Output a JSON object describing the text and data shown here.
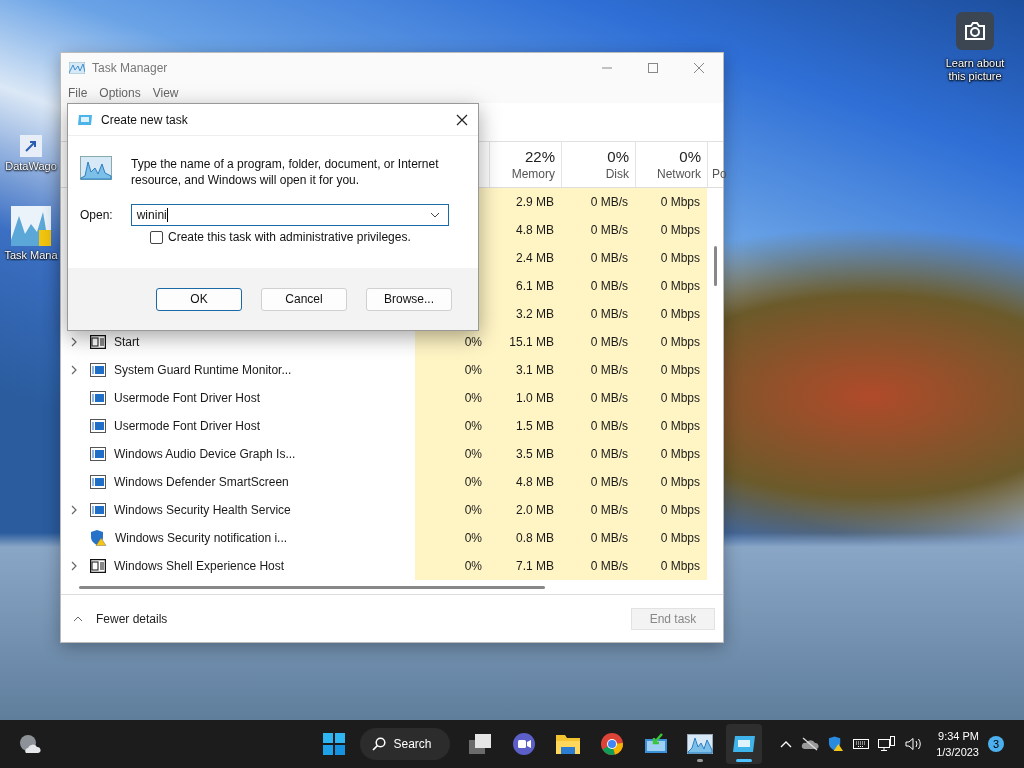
{
  "desktop": {
    "icons": [
      {
        "label": "DataWago",
        "kind": "shortcut-map"
      },
      {
        "label": "Task Mana",
        "kind": "shortcut-chart"
      }
    ],
    "spotlight": {
      "label": "Learn about this picture"
    }
  },
  "task_manager": {
    "title": "Task Manager",
    "menu": [
      "File",
      "Options",
      "View"
    ],
    "columns": [
      {
        "percent": "22%",
        "label": "Memory"
      },
      {
        "percent": "0%",
        "label": "Disk"
      },
      {
        "percent": "0%",
        "label": "Network"
      },
      {
        "label": "Po"
      }
    ],
    "rows": [
      {
        "memory": "2.9 MB",
        "disk": "0 MB/s",
        "network": "0 Mbps"
      },
      {
        "memory": "4.8 MB",
        "disk": "0 MB/s",
        "network": "0 Mbps"
      },
      {
        "memory": "2.4 MB",
        "disk": "0 MB/s",
        "network": "0 Mbps"
      },
      {
        "memory": "6.1 MB",
        "disk": "0 MB/s",
        "network": "0 Mbps"
      },
      {
        "memory": "3.2 MB",
        "disk": "0 MB/s",
        "network": "0 Mbps"
      },
      {
        "expandable": true,
        "kind": "dark-window",
        "name": "Start",
        "cpu": "0%",
        "memory": "15.1 MB",
        "disk": "0 MB/s",
        "network": "0 Mbps"
      },
      {
        "expandable": true,
        "kind": "app",
        "name": "System Guard Runtime Monitor...",
        "cpu": "0%",
        "memory": "3.1 MB",
        "disk": "0 MB/s",
        "network": "0 Mbps"
      },
      {
        "expandable": false,
        "kind": "app",
        "name": "Usermode Font Driver Host",
        "cpu": "0%",
        "memory": "1.0 MB",
        "disk": "0 MB/s",
        "network": "0 Mbps"
      },
      {
        "expandable": false,
        "kind": "app",
        "name": "Usermode Font Driver Host",
        "cpu": "0%",
        "memory": "1.5 MB",
        "disk": "0 MB/s",
        "network": "0 Mbps"
      },
      {
        "expandable": false,
        "kind": "app",
        "name": "Windows Audio Device Graph Is...",
        "cpu": "0%",
        "memory": "3.5 MB",
        "disk": "0 MB/s",
        "network": "0 Mbps"
      },
      {
        "expandable": false,
        "kind": "app",
        "name": "Windows Defender SmartScreen",
        "cpu": "0%",
        "memory": "4.8 MB",
        "disk": "0 MB/s",
        "network": "0 Mbps"
      },
      {
        "expandable": true,
        "kind": "app",
        "name": "Windows Security Health Service",
        "cpu": "0%",
        "memory": "2.0 MB",
        "disk": "0 MB/s",
        "network": "0 Mbps"
      },
      {
        "expandable": false,
        "kind": "shield",
        "name": "Windows Security notification i...",
        "cpu": "0%",
        "memory": "0.8 MB",
        "disk": "0 MB/s",
        "network": "0 Mbps"
      },
      {
        "expandable": true,
        "kind": "dark-window",
        "name": "Windows Shell Experience Host",
        "cpu": "0%",
        "memory": "7.1 MB",
        "disk": "0 MB/s",
        "network": "0 Mbps"
      }
    ],
    "footer": {
      "toggle": "Fewer details",
      "end_task": {
        "label": "End task",
        "disabled": true
      }
    }
  },
  "dialog": {
    "title": "Create new task",
    "message": "Type the name of a program, folder, document, or Internet resource, and Windows will open it for you.",
    "open_label": "Open:",
    "value": "winini",
    "admin": {
      "label": "Create this task with administrative privileges.",
      "checked": false
    },
    "buttons": [
      {
        "label": "OK",
        "default": true
      },
      {
        "label": "Cancel",
        "default": false
      },
      {
        "label": "Browse...",
        "default": false
      }
    ]
  },
  "taskbar": {
    "search": "Search",
    "apps": [
      {
        "kind": "task-view",
        "running": false,
        "active": false
      },
      {
        "kind": "chat",
        "running": false,
        "active": false
      },
      {
        "kind": "folder",
        "running": false,
        "active": false
      },
      {
        "kind": "browser",
        "running": false,
        "active": false
      },
      {
        "kind": "installer",
        "running": false,
        "active": false
      },
      {
        "kind": "task-manager",
        "running": true,
        "active": false
      },
      {
        "kind": "run-dialog",
        "running": true,
        "active": true
      }
    ],
    "clock": {
      "time": "9:34 PM",
      "date": "1/3/2023"
    },
    "notifications": "3"
  }
}
